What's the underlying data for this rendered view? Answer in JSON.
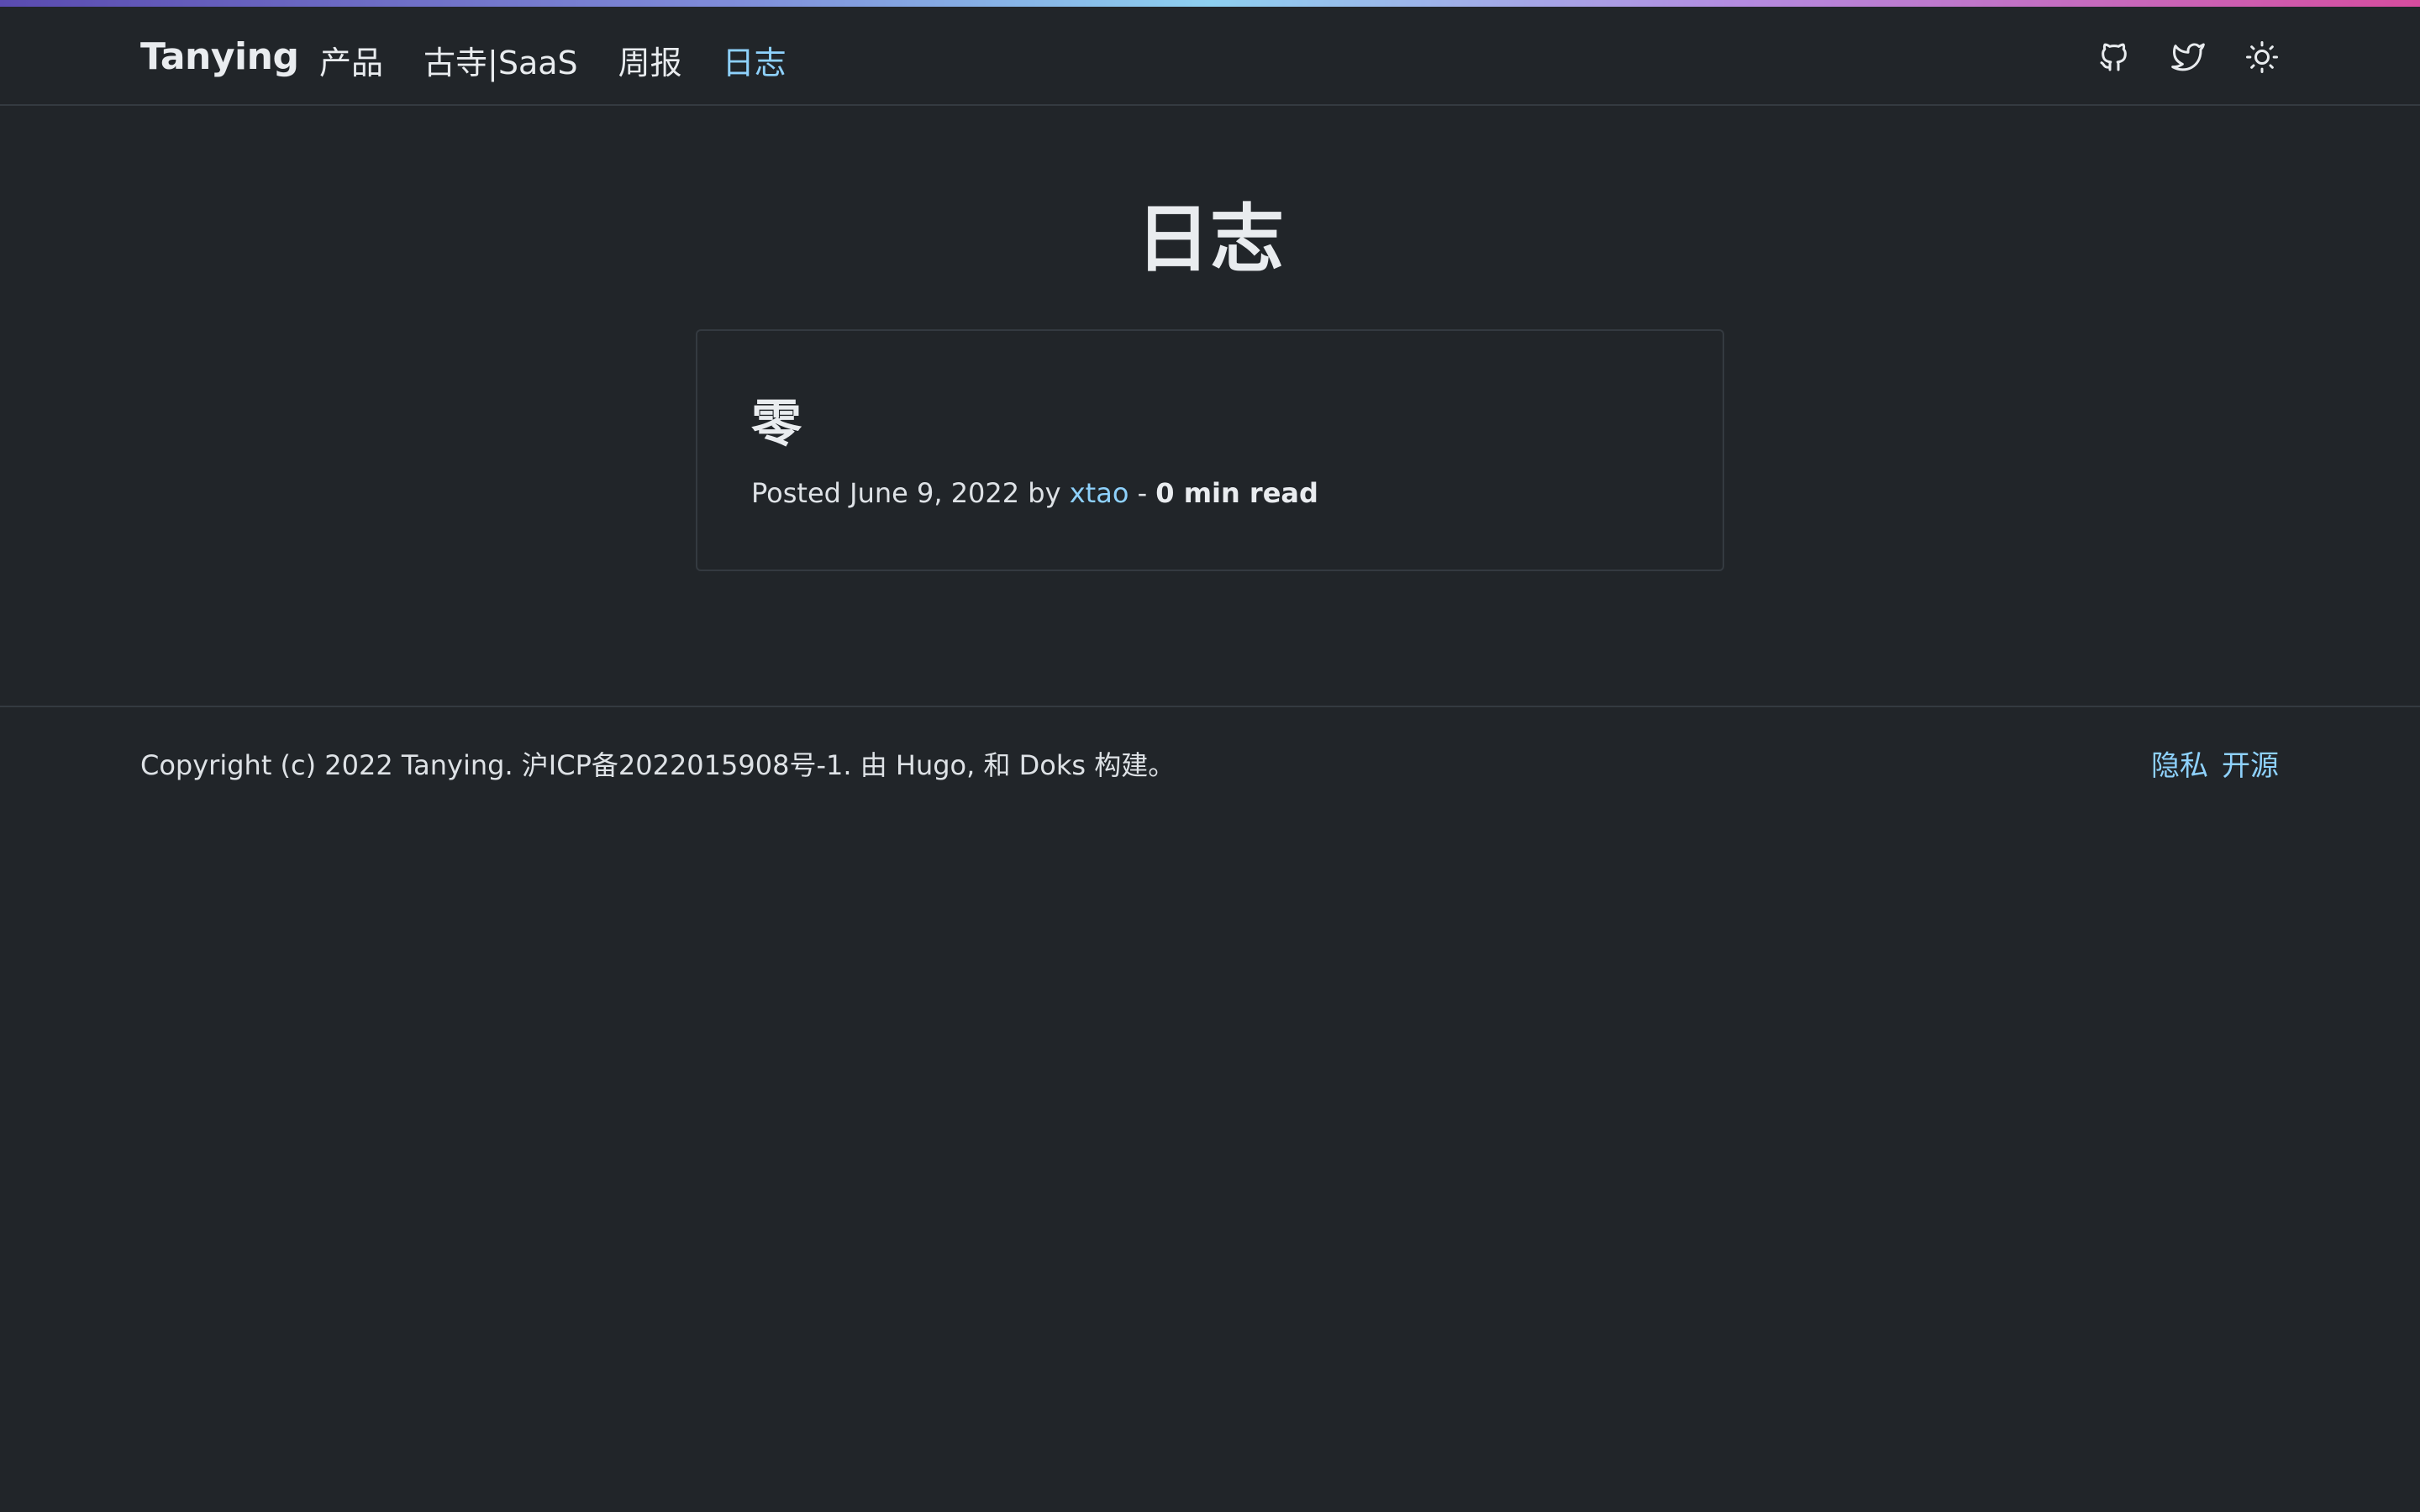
{
  "header": {
    "brand": "Tanying",
    "nav": [
      {
        "label": "产品",
        "active": false
      },
      {
        "label": "古寺|SaaS",
        "active": false
      },
      {
        "label": "周报",
        "active": false
      },
      {
        "label": "日志",
        "active": true
      }
    ],
    "icons": [
      "github-icon",
      "twitter-icon",
      "sun-icon"
    ]
  },
  "main": {
    "title": "日志",
    "post": {
      "title": "零",
      "posted_prefix": "Posted",
      "date": "June 9, 2022",
      "by": "by",
      "author": "xtao",
      "separator": "-",
      "read_time": "0 min read"
    }
  },
  "footer": {
    "copyright": "Copyright (c) 2022 Tanying. 沪ICP备2022015908号-1. 由 Hugo, 和 Doks 构建。",
    "links": [
      "隐私",
      "开源"
    ]
  },
  "colors": {
    "background": "#212529",
    "accent": "#8ed1fc",
    "border": "#343a40",
    "text": "#dee2e6"
  }
}
